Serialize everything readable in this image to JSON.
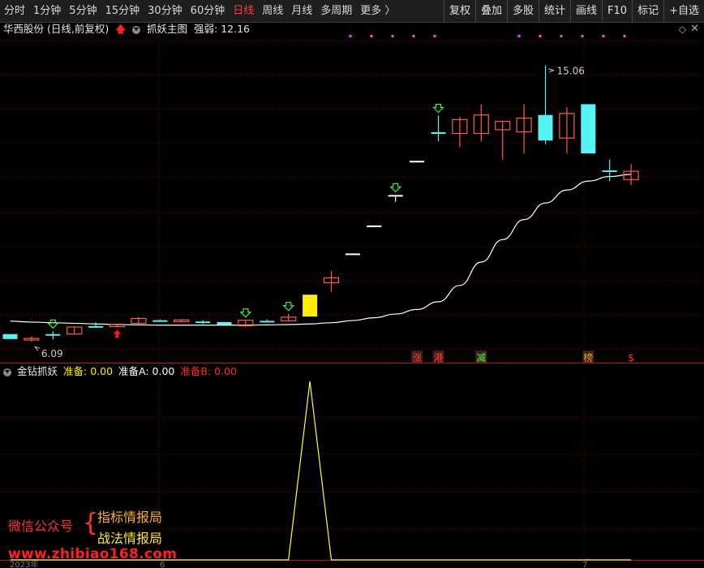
{
  "toolbar": {
    "periods": [
      "分时",
      "1分钟",
      "5分钟",
      "15分钟",
      "30分钟",
      "60分钟",
      "日线",
      "周线",
      "月线",
      "多周期",
      "更多 〉"
    ],
    "active_period": "日线",
    "right_buttons": [
      "复权",
      "叠加",
      "多股",
      "统计",
      "画线",
      "F10",
      "标记",
      "+自选"
    ]
  },
  "main_header": {
    "stock_title": "华西股份 (日线,前复权)",
    "indicator_name": "抓妖主图",
    "strength_label": "强弱:",
    "strength_value": "12.16"
  },
  "sub_header": {
    "indicator_name": "金钻抓妖",
    "prep_label": "准备:",
    "prep_value": "0.00",
    "prep_a_label": "准备A:",
    "prep_a_value": "0.00",
    "prep_b_label": "准备B:",
    "prep_b_value": "0.00"
  },
  "annotations": {
    "high_label": "15.06",
    "low_label": "6.09"
  },
  "markers": [
    "涨",
    "港",
    "减",
    "榜",
    "$"
  ],
  "chart_data": {
    "type": "candlestick",
    "price_range": [
      5.4,
      16.0
    ],
    "candles": [
      {
        "o": 6.33,
        "h": 6.33,
        "l": 6.17,
        "c": 6.17,
        "color": "cyan"
      },
      {
        "o": 6.14,
        "h": 6.26,
        "l": 6.08,
        "c": 6.19,
        "color": "red"
      },
      {
        "o": 6.33,
        "h": 6.42,
        "l": 6.16,
        "c": 6.3,
        "color": "cyan",
        "signal": "down"
      },
      {
        "o": 6.33,
        "h": 6.57,
        "l": 6.33,
        "c": 6.56,
        "color": "red"
      },
      {
        "o": 6.57,
        "h": 6.71,
        "l": 6.56,
        "c": 6.59,
        "color": "cyan"
      },
      {
        "o": 6.57,
        "h": 6.65,
        "l": 6.57,
        "c": 6.65,
        "color": "red",
        "signal": "up"
      },
      {
        "o": 6.68,
        "h": 6.88,
        "l": 6.68,
        "c": 6.84,
        "color": "red"
      },
      {
        "o": 6.78,
        "h": 6.81,
        "l": 6.74,
        "c": 6.76,
        "color": "cyan"
      },
      {
        "o": 6.77,
        "h": 6.81,
        "l": 6.75,
        "c": 6.79,
        "color": "red"
      },
      {
        "o": 6.74,
        "h": 6.78,
        "l": 6.66,
        "c": 6.74,
        "color": "cyan"
      },
      {
        "o": 6.72,
        "h": 6.72,
        "l": 6.63,
        "c": 6.63,
        "color": "cyan"
      },
      {
        "o": 6.6,
        "h": 6.78,
        "l": 6.56,
        "c": 6.78,
        "color": "red",
        "signal": "down"
      },
      {
        "o": 6.76,
        "h": 6.81,
        "l": 6.71,
        "c": 6.76,
        "color": "cyan"
      },
      {
        "o": 6.76,
        "h": 6.99,
        "l": 6.76,
        "c": 6.88,
        "color": "red",
        "signal": "down"
      },
      {
        "o": 6.9,
        "h": 7.61,
        "l": 6.9,
        "c": 7.61,
        "color": "yellow"
      },
      {
        "o": 8.0,
        "h": 8.38,
        "l": 7.7,
        "c": 8.16,
        "color": "red"
      },
      {
        "o": 8.93,
        "h": 8.95,
        "l": 8.93,
        "c": 8.95,
        "color": "white"
      },
      {
        "o": 9.85,
        "h": 9.86,
        "l": 9.85,
        "c": 9.86,
        "color": "white"
      },
      {
        "o": 10.85,
        "h": 10.85,
        "l": 10.63,
        "c": 10.85,
        "color": "white",
        "signal": "down"
      },
      {
        "o": 11.95,
        "h": 11.96,
        "l": 11.95,
        "c": 11.96,
        "color": "white"
      },
      {
        "o": 12.89,
        "h": 13.43,
        "l": 12.6,
        "c": 12.89,
        "color": "cyan",
        "signal": "down"
      },
      {
        "o": 12.85,
        "h": 13.4,
        "l": 12.4,
        "c": 13.3,
        "color": "red"
      },
      {
        "o": 12.85,
        "h": 13.8,
        "l": 12.6,
        "c": 13.45,
        "color": "red"
      },
      {
        "o": 12.97,
        "h": 13.25,
        "l": 12.0,
        "c": 13.24,
        "color": "red"
      },
      {
        "o": 12.9,
        "h": 13.8,
        "l": 12.2,
        "c": 13.35,
        "color": "red"
      },
      {
        "o": 13.45,
        "h": 15.06,
        "l": 12.5,
        "c": 12.62,
        "color": "cyan"
      },
      {
        "o": 12.7,
        "h": 13.7,
        "l": 12.2,
        "c": 13.5,
        "color": "red"
      },
      {
        "o": 13.8,
        "h": 13.8,
        "l": 12.2,
        "c": 12.2,
        "color": "cyan"
      },
      {
        "o": 11.65,
        "h": 12.0,
        "l": 11.3,
        "c": 11.65,
        "color": "cyan"
      },
      {
        "o": 11.35,
        "h": 11.85,
        "l": 11.17,
        "c": 11.62,
        "color": "red"
      }
    ],
    "ma_line": [
      6.75,
      6.72,
      6.7,
      6.68,
      6.66,
      6.64,
      6.63,
      6.62,
      6.62,
      6.62,
      6.62,
      6.62,
      6.63,
      6.64,
      6.66,
      6.7,
      6.77,
      6.86,
      6.98,
      7.13,
      7.38,
      7.91,
      8.67,
      9.4,
      10.05,
      10.59,
      11.01,
      11.3,
      11.45,
      11.52
    ],
    "marker_positions": [
      19,
      20,
      22,
      27,
      29
    ],
    "sub_indicator": {
      "name": "金钻抓妖",
      "values": [
        0,
        0,
        0,
        0,
        0,
        0,
        0,
        0,
        0,
        0,
        0,
        0,
        0,
        0,
        1,
        0,
        0,
        0,
        0,
        0,
        0,
        0,
        0,
        0,
        0,
        0,
        0,
        0,
        0,
        0
      ]
    }
  },
  "watermark": {
    "left_text": "微信公众号",
    "line1": "指标情报局",
    "line2": "战法情报局",
    "url": "www.zhibiao168.com"
  },
  "bottom_axis": {
    "left_label": "2023年",
    "mid_label": "6",
    "right_label": "7"
  },
  "colors": {
    "up": "#ff5a50",
    "down": "#55f5f5",
    "yellow": "#ffee00",
    "flat": "#ffffff",
    "signal_green": "#40ff40",
    "signal_red": "#ff1a1a",
    "grid": "#8b0000",
    "ma": "#ffffff",
    "sub_line": "#ffff30",
    "magenta": "#ff40ff"
  }
}
